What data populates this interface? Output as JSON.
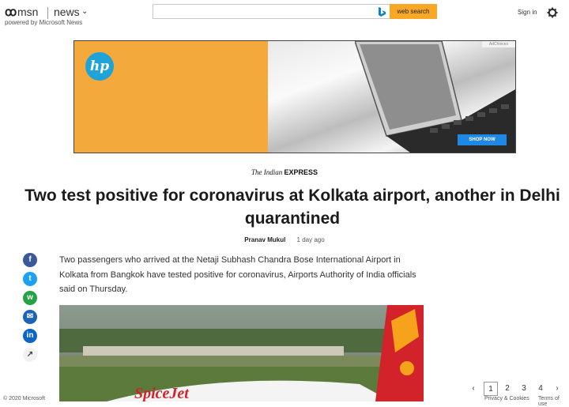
{
  "header": {
    "brand": "msn",
    "section": "news",
    "powered_by": "powered by Microsoft News",
    "search": {
      "value": "",
      "button_label": "web search"
    },
    "sign_in": "Sign in"
  },
  "ad": {
    "brand": "hp",
    "adchoices": "AdChoices",
    "cta": "SHOP NOW"
  },
  "article": {
    "publisher_prefix": "The Indian",
    "publisher_name": "EXPRESS",
    "title": "Two test positive for coronavirus at Kolkata airport, another in Delhi quarantined",
    "author": "Pranav Mukul",
    "timestamp": "1 day ago",
    "body": "Two passengers who arrived at the Netaji Subhash Chandra Bose International Airport in Kolkata from Bangkok have tested positive for coronavirus, Airports Authority of India officials said on Thursday."
  },
  "share": {
    "facebook": "f",
    "twitter": "t",
    "whatsapp": "w",
    "email": "✉",
    "linkedin": "in",
    "more": "↗"
  },
  "footer": {
    "copyright": "© 2020 Microsoft",
    "pages": [
      "1",
      "2",
      "3",
      "4"
    ],
    "current_page": "1",
    "privacy": "Privacy & Cookies",
    "terms": "Terms of use"
  },
  "colors": {
    "search_button": "#f9a825",
    "ad_orange": "#f4a93c",
    "hp_blue": "#1fa3d8",
    "shop_now": "#1e88e5",
    "facebook": "#3b5998",
    "twitter": "#1da1f2",
    "whatsapp": "#25a244",
    "email": "#1b63b6",
    "linkedin": "#0a66c2"
  }
}
